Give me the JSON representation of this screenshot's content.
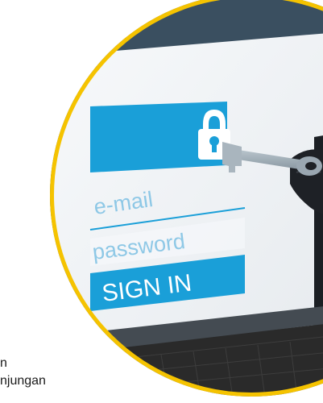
{
  "login": {
    "email_placeholder": "e-mail",
    "password_placeholder": "password",
    "sign_in_label": "SIGN IN"
  },
  "side_caption": {
    "line1": "n",
    "line2": "njungan"
  },
  "icons": {
    "lock": "lock-icon",
    "key": "key-icon",
    "glove": "gloved-hand"
  },
  "colors": {
    "ring": "#f5c300",
    "accent_blue": "#1a9fd8",
    "panel": "#f3f5f7",
    "keyboard": "#2a2a2a"
  }
}
